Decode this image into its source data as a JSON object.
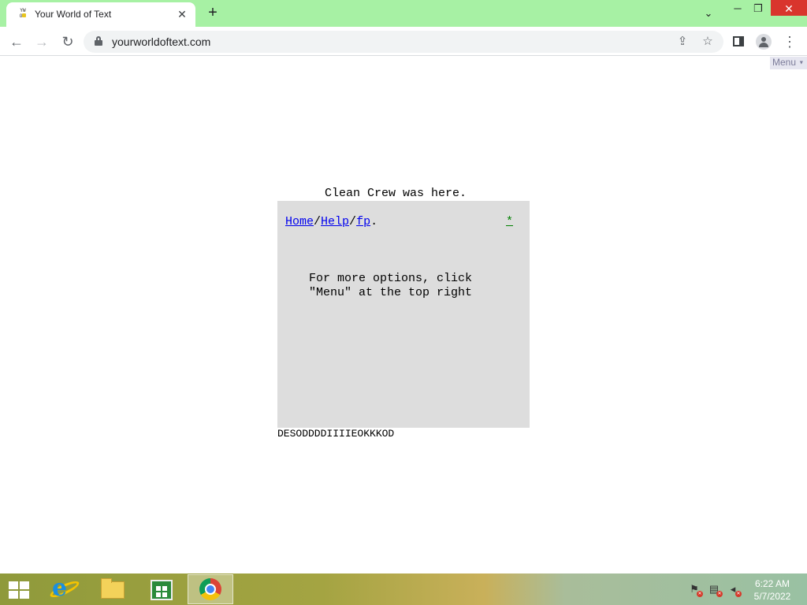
{
  "browser": {
    "tab": {
      "title": "Your World of Text",
      "favicon_text": "YW OT"
    },
    "address": {
      "url": "yourworldoftext.com"
    },
    "colors": {
      "frame": "#a7f1a4",
      "close_button": "#d9352d"
    }
  },
  "page": {
    "menu_label": "Menu",
    "top_line": "Clean Crew was here.",
    "breadcrumb": {
      "home": "Home",
      "help": "Help",
      "fp": "fp",
      "sep": "/",
      "end": "."
    },
    "star_link": "*",
    "info_line1": "For more options, click",
    "info_line2": "\"Menu\" at the top right",
    "bottom_line": "DESODDDDIIIIEOKKKOD"
  },
  "taskbar": {
    "pinned": [
      "start",
      "internet-explorer",
      "file-explorer",
      "store",
      "chrome"
    ],
    "clock": {
      "time": "6:22 AM",
      "date": "5/7/2022"
    }
  }
}
